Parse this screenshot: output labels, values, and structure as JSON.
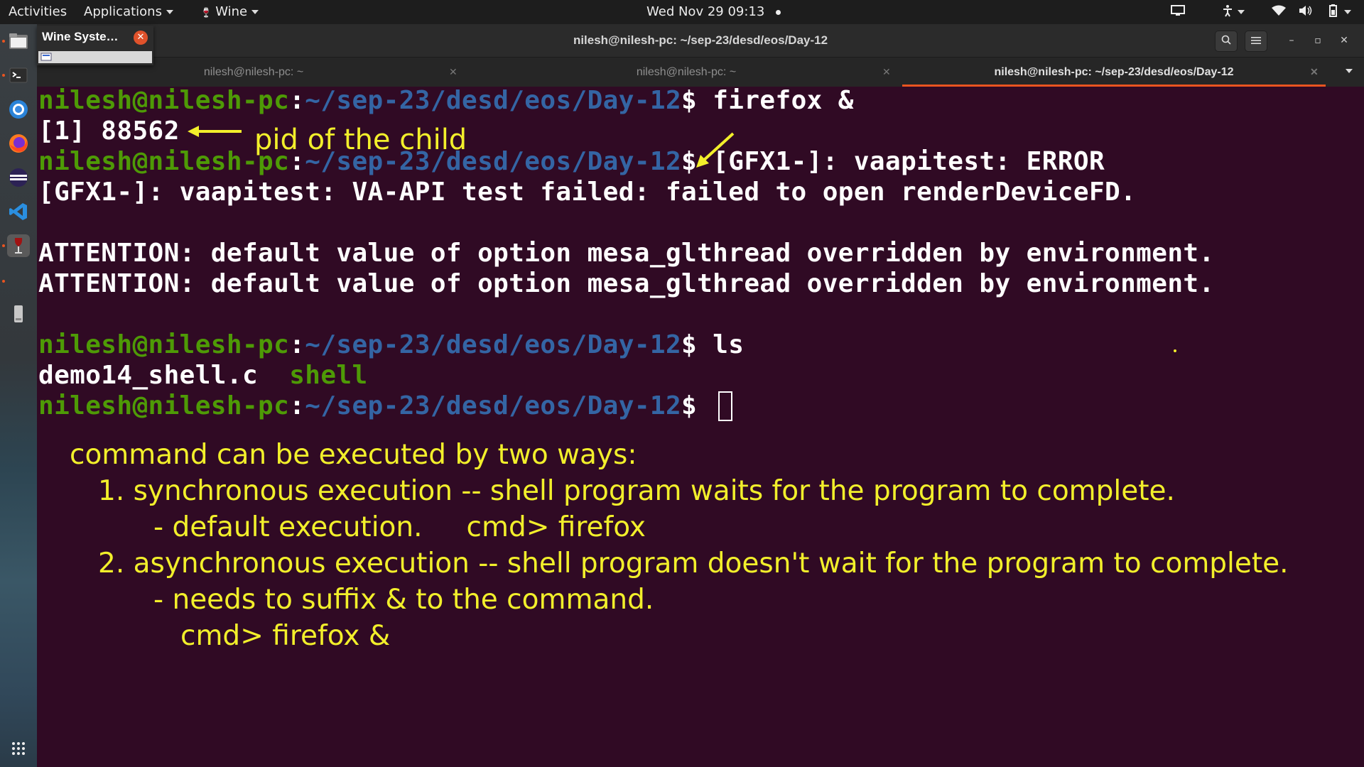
{
  "topbar": {
    "activities": "Activities",
    "applications": "Applications",
    "wine": "Wine",
    "clock": "Wed Nov 29  09:13"
  },
  "wine_popup": {
    "title": "Wine Syste…"
  },
  "window": {
    "title": "nilesh@nilesh-pc: ~/sep-23/desd/eos/Day-12",
    "tabs": [
      {
        "label": "nilesh@nilesh-pc: ~"
      },
      {
        "label": "nilesh@nilesh-pc: ~"
      },
      {
        "label": "nilesh@nilesh-pc: ~/sep-23/desd/eos/Day-12"
      }
    ]
  },
  "terminal": {
    "user_host": "nilesh@nilesh-pc",
    "path": "~/sep-23/desd/eos/Day-12",
    "lines": [
      {
        "cmd": " firefox &"
      },
      {
        "text": "[1] 88562"
      },
      {
        "cmd": " [GFX1-]: vaapitest: ERROR"
      },
      {
        "text": "[GFX1-]: vaapitest: VA-API test failed: failed to open renderDeviceFD."
      },
      {
        "text": ""
      },
      {
        "text": "ATTENTION: default value of option mesa_glthread overridden by environment."
      },
      {
        "text": "ATTENTION: default value of option mesa_glthread overridden by environment."
      },
      {
        "text": ""
      },
      {
        "cmd": " ls"
      },
      {
        "file": "demo14_shell.c",
        "dir": "shell"
      },
      {
        "cmd": " "
      }
    ]
  },
  "annotations": {
    "pid_label": "pid of the child",
    "notes": [
      "command can be executed by two ways:",
      "1. synchronous execution -- shell program waits for the program to complete.",
      "- default execution.     cmd> firefox",
      "2. asynchronous execution -- shell program doesn't wait for the program to complete.",
      "- needs to suffix & to the command.",
      "cmd> firefox &"
    ]
  },
  "colors": {
    "background": "#300a24",
    "prompt_user": "#4e9a06",
    "prompt_path": "#3465a4",
    "annotation": "#f2ef2b",
    "accent": "#e95420"
  }
}
